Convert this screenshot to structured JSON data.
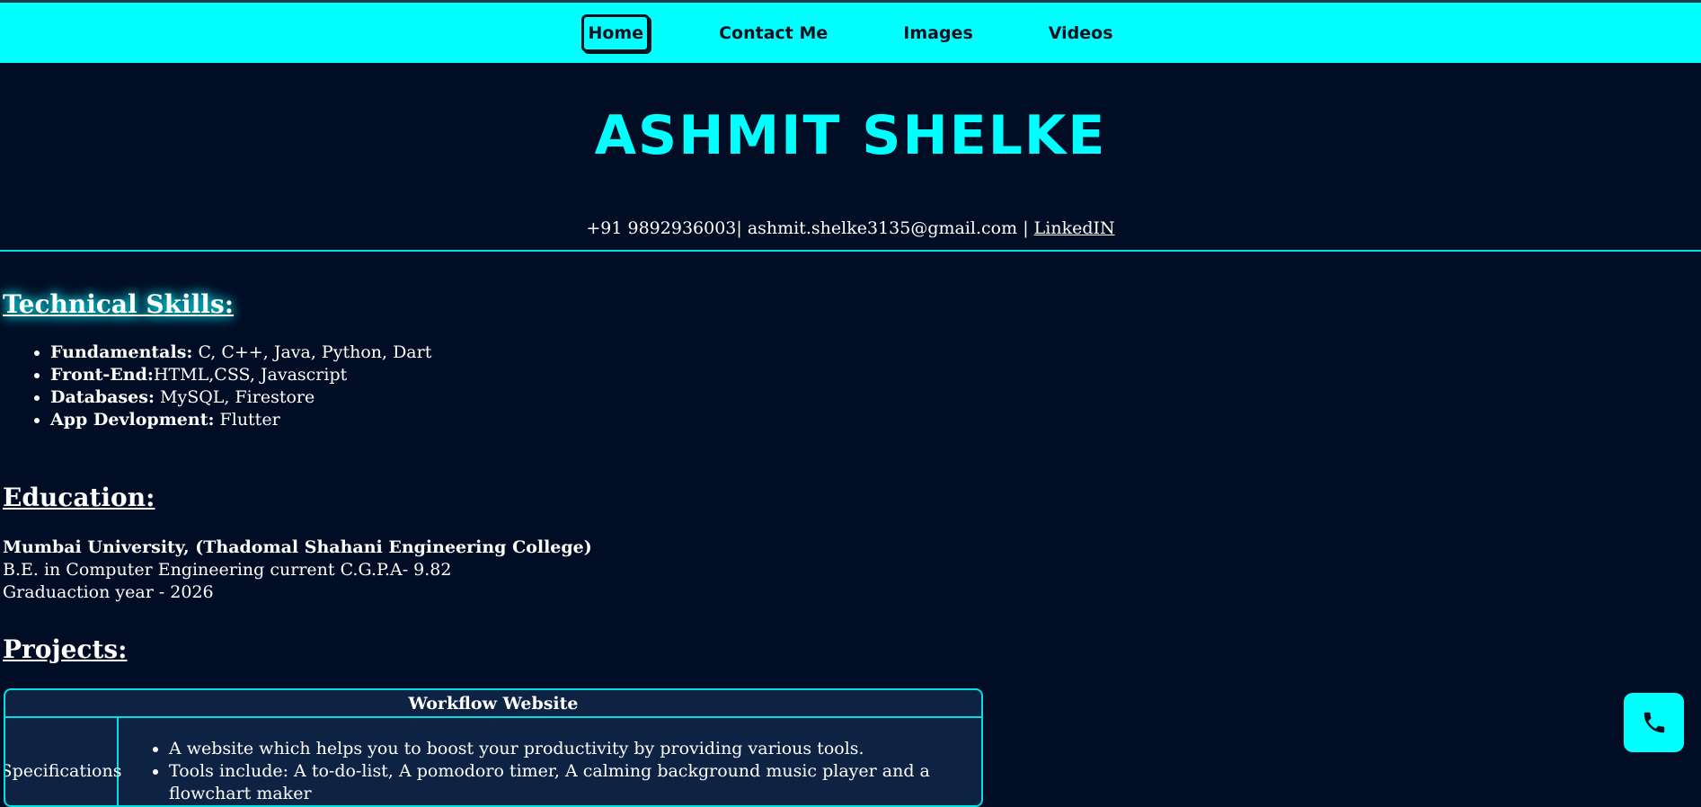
{
  "nav": {
    "items": [
      {
        "label": "Home",
        "active": true
      },
      {
        "label": "Contact Me",
        "active": false
      },
      {
        "label": "Images",
        "active": false
      },
      {
        "label": "Videos",
        "active": false
      }
    ]
  },
  "header": {
    "name": "ASHMIT SHELKE",
    "phone": "+91 9892936003",
    "separator1": "| ",
    "email": "ashmit.shelke3135@gmail.com",
    "separator2": " | ",
    "linkedin_label": "LinkedIN"
  },
  "skills": {
    "title": "Technical Skills:",
    "items": [
      {
        "key": "Fundamentals:",
        "value": " C, C++, Java, Python, Dart"
      },
      {
        "key": "Front-End:",
        "value": "HTML,CSS, Javascript"
      },
      {
        "key": "Databases:",
        "value": " MySQL, Firestore"
      },
      {
        "key": "App Devlopment:",
        "value": " Flutter"
      }
    ]
  },
  "education": {
    "title": "Education:",
    "university": "Mumbai University, (Thadomal Shahani Engineering College)",
    "degree": "B.E. in Computer Engineering current C.G.P.A- 9.82",
    "graduation": "Graduaction year - 2026"
  },
  "projects": {
    "title": "Projects:",
    "items": [
      {
        "name": "Workflow Website",
        "spec_label": "Specifications",
        "specs": [
          "A website which helps you to boost your productivity by providing various tools.",
          "Tools include: A to-do-list, A pomodoro timer, A calming background music player and a flowchart maker"
        ]
      }
    ]
  },
  "icons": {
    "phone": "phone-icon"
  },
  "colors": {
    "accent": "#00ffff",
    "background": "#010d24",
    "table_bg": "#0e2343"
  }
}
